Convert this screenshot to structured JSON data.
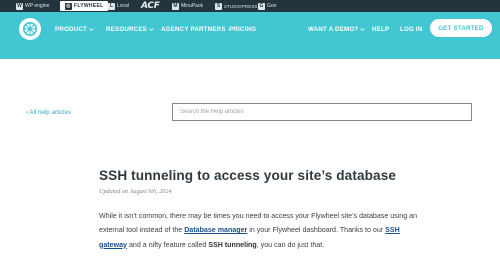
{
  "brandbar": {
    "items": [
      {
        "label": "WP engine",
        "icon": "wp-engine-icon"
      },
      {
        "label": "FLYWHEEL",
        "icon": "flywheel-icon",
        "active": true
      },
      {
        "label": "Local",
        "icon": "local-icon"
      },
      {
        "label": "ACF",
        "icon": "acf-logo"
      },
      {
        "label": "MinuPack",
        "icon": "minupack-icon"
      },
      {
        "label": "STUDIOPRESS",
        "icon": "studiopress-icon"
      },
      {
        "label": "Goo",
        "icon": "genesis-icon"
      }
    ]
  },
  "nav": {
    "logo": "flywheel-logo",
    "product": "PRODUCT",
    "resources": "RESOURCES",
    "agency": "AGENCY PARTNERS",
    "pricing": "PRICING",
    "demo": "WANT A DEMO?",
    "help": "HELP",
    "login": "LOG IN",
    "cta": "GET STARTED"
  },
  "colors": {
    "accent": "#41c6d2",
    "brandbar": "#24343c",
    "link": "#1a4e8c"
  },
  "search": {
    "back_link": "‹ All help articles",
    "placeholder": "Search the Help articles",
    "value": ""
  },
  "article": {
    "title": "SSH tunneling to access your site’s database",
    "updated": "Updated on August 6th, 2024",
    "p1_a": "While it isn’t common, there may be times you need to access your Flywheel site’s database using an external tool instead of the ",
    "link_db": "Database manager",
    "p1_b": " in your Flywheel dashboard. Thanks to our ",
    "link_ssh": "SSH gateway",
    "p1_c": " and a nifty feature called ",
    "bold_ssh": "SSH tunneling",
    "p1_d": ", you can do just that."
  }
}
